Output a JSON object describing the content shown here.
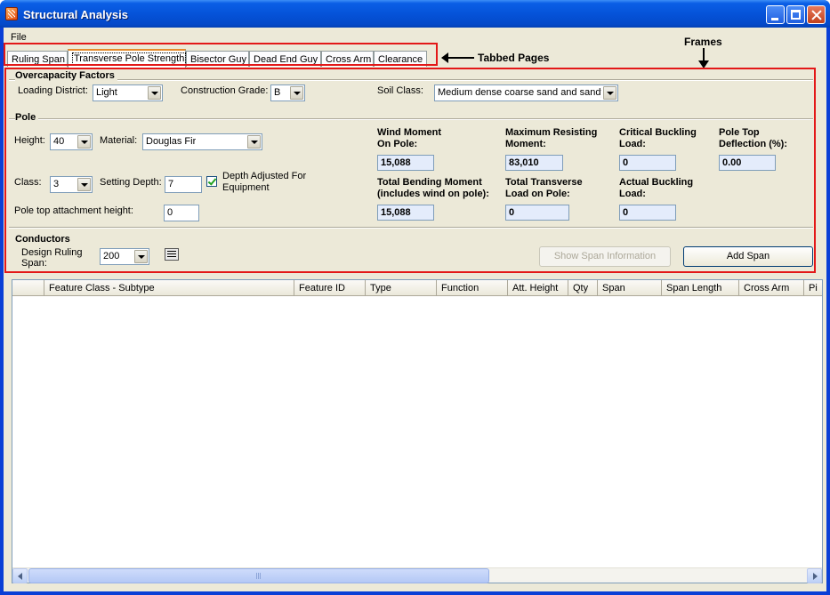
{
  "window": {
    "title": "Structural Analysis"
  },
  "menu": {
    "file": "File"
  },
  "tabs": [
    {
      "label": "Ruling Span",
      "active": false
    },
    {
      "label": "Transverse Pole Strength",
      "active": true
    },
    {
      "label": "Bisector Guy",
      "active": false
    },
    {
      "label": "Dead End Guy",
      "active": false
    },
    {
      "label": "Cross Arm",
      "active": false
    },
    {
      "label": "Clearance",
      "active": false
    }
  ],
  "annotations": {
    "tabbed_pages": "Tabbed Pages",
    "frames": "Frames"
  },
  "overcapacity": {
    "title": "Overcapacity Factors",
    "loading_district_label": "Loading District:",
    "loading_district_value": "Light",
    "construction_grade_label": "Construction Grade:",
    "construction_grade_value": "B",
    "soil_class_label": "Soil Class:",
    "soil_class_value": "Medium dense coarse sand and sandy"
  },
  "pole": {
    "title": "Pole",
    "height_label": "Height:",
    "height_value": "40",
    "material_label": "Material:",
    "material_value": "Douglas Fir",
    "class_label": "Class:",
    "class_value": "3",
    "setting_depth_label": "Setting Depth:",
    "setting_depth_value": "7",
    "depth_adjusted_label_1": "Depth Adjusted For",
    "depth_adjusted_label_2": "Equipment",
    "depth_adjusted_checked": true,
    "attach_height_label": "Pole top attachment height:",
    "attach_height_value": "0",
    "wind_moment_label_1": "Wind Moment",
    "wind_moment_label_2": "On Pole:",
    "wind_moment_value": "15,088",
    "max_resisting_label_1": "Maximum Resisting",
    "max_resisting_label_2": "Moment:",
    "max_resisting_value": "83,010",
    "critical_buckling_label_1": "Critical Buckling",
    "critical_buckling_label_2": "Load:",
    "critical_buckling_value": "0",
    "pole_top_deflection_label_1": "Pole Top",
    "pole_top_deflection_label_2": "Deflection (%):",
    "pole_top_deflection_value": "0.00",
    "total_bending_label_1": "Total Bending Moment",
    "total_bending_label_2": "(includes wind on pole):",
    "total_bending_value": "15,088",
    "total_transverse_label_1": "Total Transverse",
    "total_transverse_label_2": "Load on Pole:",
    "total_transverse_value": "0",
    "actual_buckling_label_1": "Actual Buckling",
    "actual_buckling_label_2": "Load:",
    "actual_buckling_value": "0"
  },
  "conductors": {
    "title": "Conductors",
    "design_ruling_span_label_1": "Design Ruling",
    "design_ruling_span_label_2": "Span:",
    "design_ruling_span_value": "200",
    "show_span_button": "Show Span Information",
    "add_span_button": "Add Span"
  },
  "grid": {
    "columns": [
      "",
      "Feature Class - Subtype",
      "Feature ID",
      "Type",
      "Function",
      "Att. Height",
      "Qty",
      "Span",
      "Span Length",
      "Cross Arm",
      "Pi"
    ]
  }
}
